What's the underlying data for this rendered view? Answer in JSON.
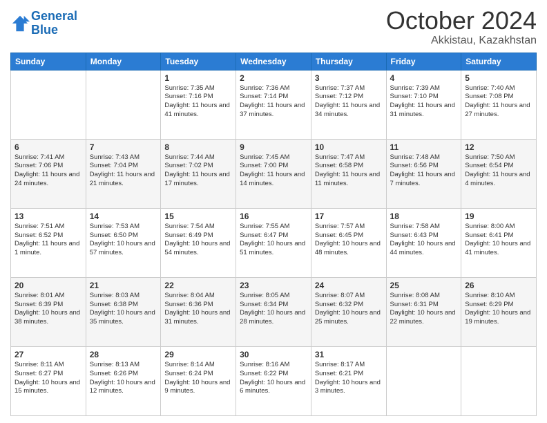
{
  "header": {
    "logo_line1": "General",
    "logo_line2": "Blue",
    "month": "October 2024",
    "location": "Akkistau, Kazakhstan"
  },
  "days_of_week": [
    "Sunday",
    "Monday",
    "Tuesday",
    "Wednesday",
    "Thursday",
    "Friday",
    "Saturday"
  ],
  "weeks": [
    [
      {
        "day": "",
        "info": ""
      },
      {
        "day": "",
        "info": ""
      },
      {
        "day": "1",
        "info": "Sunrise: 7:35 AM\nSunset: 7:16 PM\nDaylight: 11 hours and 41 minutes."
      },
      {
        "day": "2",
        "info": "Sunrise: 7:36 AM\nSunset: 7:14 PM\nDaylight: 11 hours and 37 minutes."
      },
      {
        "day": "3",
        "info": "Sunrise: 7:37 AM\nSunset: 7:12 PM\nDaylight: 11 hours and 34 minutes."
      },
      {
        "day": "4",
        "info": "Sunrise: 7:39 AM\nSunset: 7:10 PM\nDaylight: 11 hours and 31 minutes."
      },
      {
        "day": "5",
        "info": "Sunrise: 7:40 AM\nSunset: 7:08 PM\nDaylight: 11 hours and 27 minutes."
      }
    ],
    [
      {
        "day": "6",
        "info": "Sunrise: 7:41 AM\nSunset: 7:06 PM\nDaylight: 11 hours and 24 minutes."
      },
      {
        "day": "7",
        "info": "Sunrise: 7:43 AM\nSunset: 7:04 PM\nDaylight: 11 hours and 21 minutes."
      },
      {
        "day": "8",
        "info": "Sunrise: 7:44 AM\nSunset: 7:02 PM\nDaylight: 11 hours and 17 minutes."
      },
      {
        "day": "9",
        "info": "Sunrise: 7:45 AM\nSunset: 7:00 PM\nDaylight: 11 hours and 14 minutes."
      },
      {
        "day": "10",
        "info": "Sunrise: 7:47 AM\nSunset: 6:58 PM\nDaylight: 11 hours and 11 minutes."
      },
      {
        "day": "11",
        "info": "Sunrise: 7:48 AM\nSunset: 6:56 PM\nDaylight: 11 hours and 7 minutes."
      },
      {
        "day": "12",
        "info": "Sunrise: 7:50 AM\nSunset: 6:54 PM\nDaylight: 11 hours and 4 minutes."
      }
    ],
    [
      {
        "day": "13",
        "info": "Sunrise: 7:51 AM\nSunset: 6:52 PM\nDaylight: 11 hours and 1 minute."
      },
      {
        "day": "14",
        "info": "Sunrise: 7:53 AM\nSunset: 6:50 PM\nDaylight: 10 hours and 57 minutes."
      },
      {
        "day": "15",
        "info": "Sunrise: 7:54 AM\nSunset: 6:49 PM\nDaylight: 10 hours and 54 minutes."
      },
      {
        "day": "16",
        "info": "Sunrise: 7:55 AM\nSunset: 6:47 PM\nDaylight: 10 hours and 51 minutes."
      },
      {
        "day": "17",
        "info": "Sunrise: 7:57 AM\nSunset: 6:45 PM\nDaylight: 10 hours and 48 minutes."
      },
      {
        "day": "18",
        "info": "Sunrise: 7:58 AM\nSunset: 6:43 PM\nDaylight: 10 hours and 44 minutes."
      },
      {
        "day": "19",
        "info": "Sunrise: 8:00 AM\nSunset: 6:41 PM\nDaylight: 10 hours and 41 minutes."
      }
    ],
    [
      {
        "day": "20",
        "info": "Sunrise: 8:01 AM\nSunset: 6:39 PM\nDaylight: 10 hours and 38 minutes."
      },
      {
        "day": "21",
        "info": "Sunrise: 8:03 AM\nSunset: 6:38 PM\nDaylight: 10 hours and 35 minutes."
      },
      {
        "day": "22",
        "info": "Sunrise: 8:04 AM\nSunset: 6:36 PM\nDaylight: 10 hours and 31 minutes."
      },
      {
        "day": "23",
        "info": "Sunrise: 8:05 AM\nSunset: 6:34 PM\nDaylight: 10 hours and 28 minutes."
      },
      {
        "day": "24",
        "info": "Sunrise: 8:07 AM\nSunset: 6:32 PM\nDaylight: 10 hours and 25 minutes."
      },
      {
        "day": "25",
        "info": "Sunrise: 8:08 AM\nSunset: 6:31 PM\nDaylight: 10 hours and 22 minutes."
      },
      {
        "day": "26",
        "info": "Sunrise: 8:10 AM\nSunset: 6:29 PM\nDaylight: 10 hours and 19 minutes."
      }
    ],
    [
      {
        "day": "27",
        "info": "Sunrise: 8:11 AM\nSunset: 6:27 PM\nDaylight: 10 hours and 15 minutes."
      },
      {
        "day": "28",
        "info": "Sunrise: 8:13 AM\nSunset: 6:26 PM\nDaylight: 10 hours and 12 minutes."
      },
      {
        "day": "29",
        "info": "Sunrise: 8:14 AM\nSunset: 6:24 PM\nDaylight: 10 hours and 9 minutes."
      },
      {
        "day": "30",
        "info": "Sunrise: 8:16 AM\nSunset: 6:22 PM\nDaylight: 10 hours and 6 minutes."
      },
      {
        "day": "31",
        "info": "Sunrise: 8:17 AM\nSunset: 6:21 PM\nDaylight: 10 hours and 3 minutes."
      },
      {
        "day": "",
        "info": ""
      },
      {
        "day": "",
        "info": ""
      }
    ]
  ]
}
